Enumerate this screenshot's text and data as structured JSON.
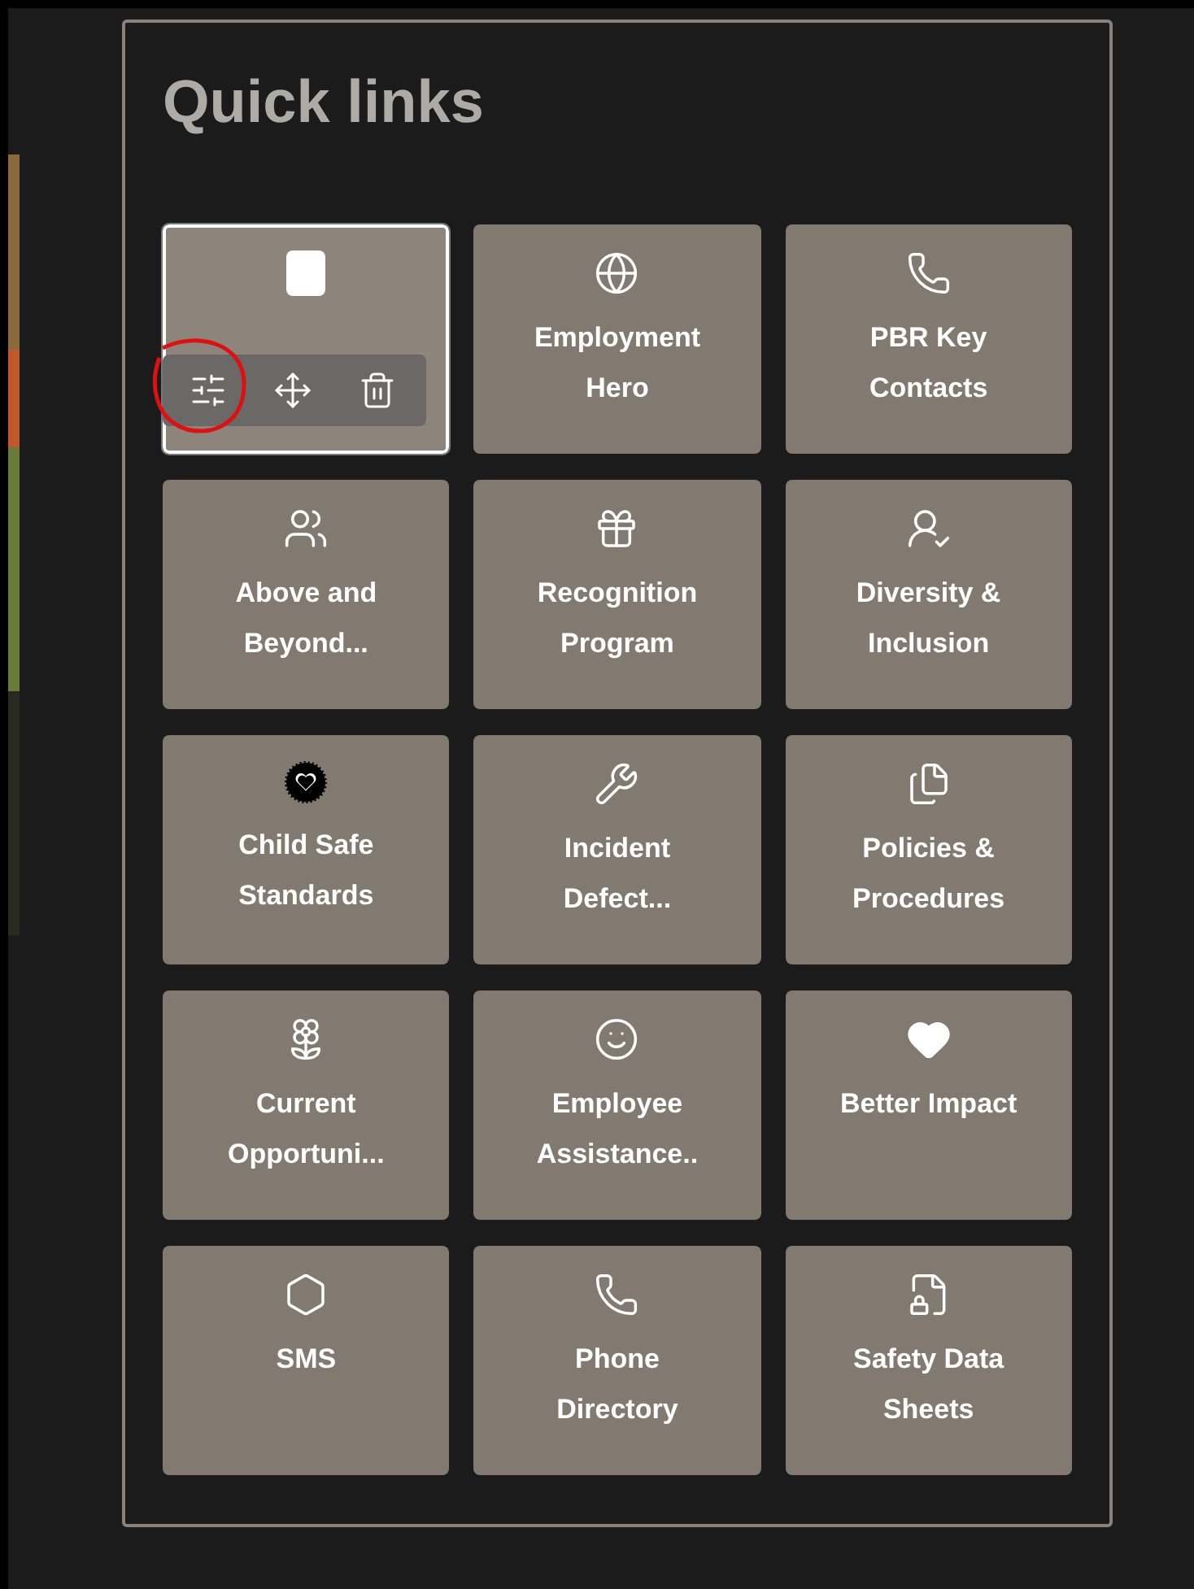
{
  "title": "Quick links",
  "links": [
    {
      "selected": true
    },
    {
      "label": "Employment Hero",
      "selected": false
    },
    {
      "label": "PBR Key Contacts",
      "selected": false
    },
    {
      "label": "Above and Beyond...",
      "selected": false
    },
    {
      "label": "Recognition Program",
      "selected": false
    },
    {
      "label": "Diversity & Inclusion",
      "selected": false
    },
    {
      "label": "Child Safe Standards",
      "selected": false
    },
    {
      "label": "Incident Defect...",
      "selected": false
    },
    {
      "label": "Policies & Procedures",
      "selected": false
    },
    {
      "label": "Current Opportuni...",
      "selected": false
    },
    {
      "label": "Employee Assistance..",
      "selected": false
    },
    {
      "label": "Better Impact",
      "selected": false
    },
    {
      "label": "SMS",
      "selected": false
    },
    {
      "label": "Phone Directory",
      "selected": false
    },
    {
      "label": "Safety Data Sheets",
      "selected": false
    }
  ]
}
